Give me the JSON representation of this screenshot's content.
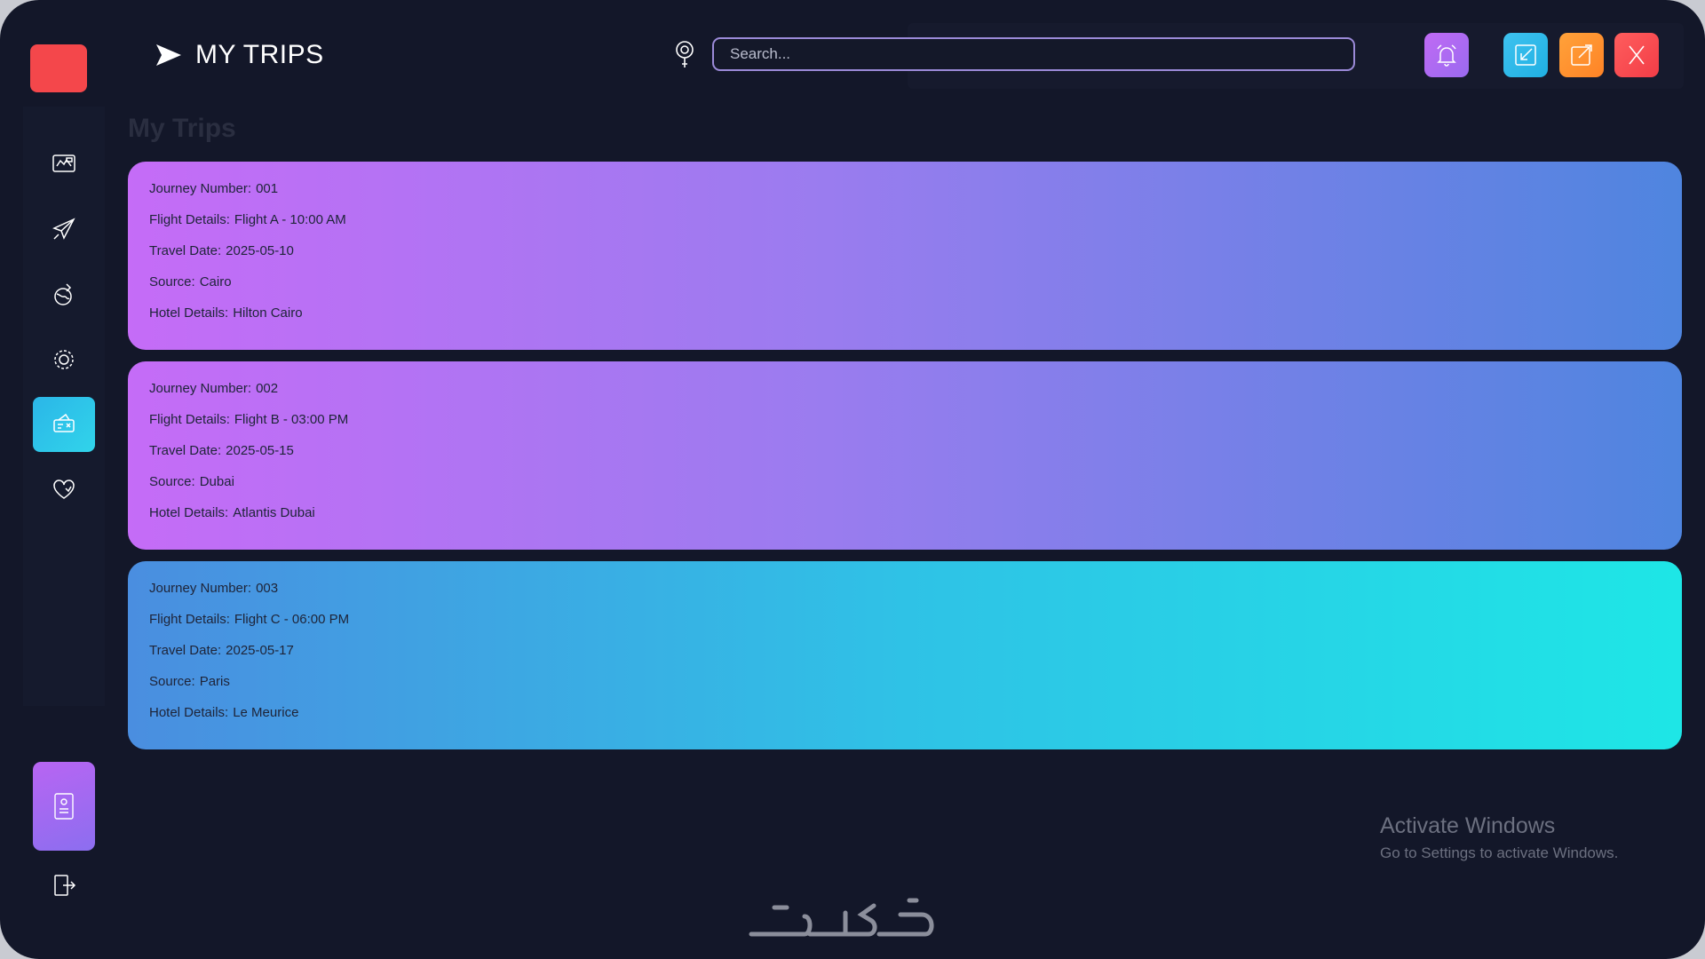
{
  "app": {
    "title": "MY TRIPS"
  },
  "search": {
    "placeholder": "Search..."
  },
  "page": {
    "heading": "My Trips"
  },
  "labels": {
    "journey": "Journey Number:",
    "flight": "Flight Details:",
    "date": "Travel Date:",
    "source": "Source:",
    "hotel": "Hotel Details:"
  },
  "sidebar": {
    "items": [
      {
        "icon": "dashboard-icon",
        "active": false
      },
      {
        "icon": "flight-icon",
        "active": false
      },
      {
        "icon": "world-icon",
        "active": false
      },
      {
        "icon": "gear-icon",
        "active": false
      },
      {
        "icon": "tickets-icon",
        "active": true
      },
      {
        "icon": "heart-icon",
        "active": false
      }
    ],
    "bottom": [
      "profile-card-icon",
      "logout-icon"
    ]
  },
  "header": {
    "buttons": [
      "bell-icon",
      "minimize-icon",
      "maximize-icon",
      "close-icon"
    ]
  },
  "trips": [
    {
      "journey": "001",
      "flight": "Flight A - 10:00 AM",
      "date": "2025-05-10",
      "source": "Cairo",
      "hotel": "Hilton Cairo"
    },
    {
      "journey": "002",
      "flight": "Flight B - 03:00 PM",
      "date": "2025-05-15",
      "source": "Dubai",
      "hotel": "Atlantis Dubai"
    },
    {
      "journey": "003",
      "flight": "Flight C - 06:00 PM",
      "date": "2025-05-17",
      "source": "Paris",
      "hotel": "Le Meurice"
    }
  ],
  "os_watermark": {
    "title": "Activate Windows",
    "subtitle": "Go to Settings to activate Windows."
  },
  "colors": {
    "background": "#131729",
    "accent_red": "#f4474b",
    "card_purple": "#c56cf7",
    "card_blue": "#4f85df",
    "card_cyan": "#1ee6e6"
  }
}
